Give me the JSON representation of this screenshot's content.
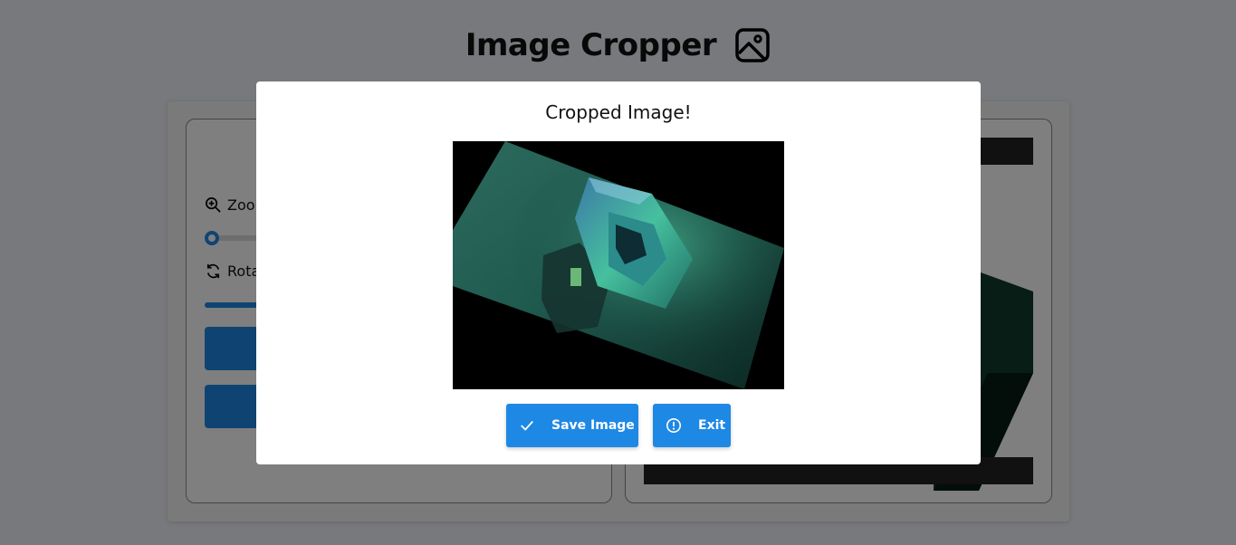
{
  "header": {
    "title": "Image Cropper",
    "icon": "image-icon"
  },
  "controls": {
    "zoom_label": "Zoom",
    "zoom_icon": "zoom-in-icon",
    "zoom_value": 0,
    "rotate_label": "Rotate",
    "rotate_icon": "rotate-icon"
  },
  "modal": {
    "title": "Cropped Image!",
    "save_label": "Save Image",
    "save_icon": "check-icon",
    "exit_label": "Exit",
    "exit_icon": "alert-circle-icon"
  },
  "colors": {
    "accent": "#1e88e5",
    "overlay": "rgba(0,0,0,0.5)",
    "page_bg": "#eef2f8"
  }
}
